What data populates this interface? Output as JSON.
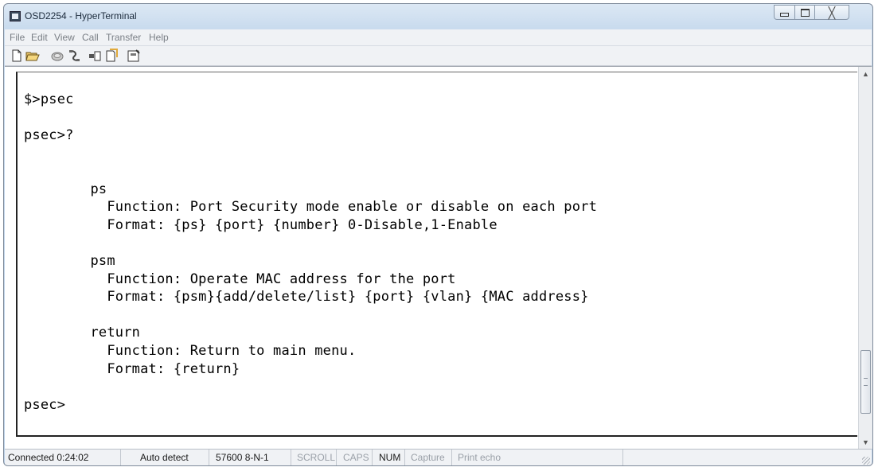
{
  "window": {
    "title": "OSD2254 - HyperTerminal",
    "close_glyph": "╳"
  },
  "menu": [
    "File",
    "Edit",
    "View",
    "Call",
    "Transfer",
    "Help"
  ],
  "toolbar": {
    "icons": [
      "new-icon",
      "open-icon",
      "connect-icon",
      "disconnect-icon",
      "send-icon",
      "receive-icon",
      "properties-icon"
    ]
  },
  "terminal": {
    "lines": [
      "$>psec",
      "",
      "psec>?",
      "",
      "",
      "        ps",
      "          Function: Port Security mode enable or disable on each port",
      "          Format: {ps} {port} {number} 0-Disable,1-Enable",
      "",
      "        psm",
      "          Function: Operate MAC address for the port",
      "          Format: {psm}{add/delete/list} {port} {vlan} {MAC address}",
      "",
      "        return",
      "          Function: Return to main menu.",
      "          Format: {return}",
      "",
      "psec>"
    ]
  },
  "scrollbar": {
    "up_glyph": "▲",
    "down_glyph": "▼",
    "thumb_position": 0.78
  },
  "status": {
    "connected": "Connected 0:24:02",
    "detect": "Auto detect",
    "settings": "57600 8-N-1",
    "scroll": "SCROLL",
    "caps": "CAPS",
    "num": "NUM",
    "capture": "Capture",
    "print_echo": "Print echo"
  }
}
